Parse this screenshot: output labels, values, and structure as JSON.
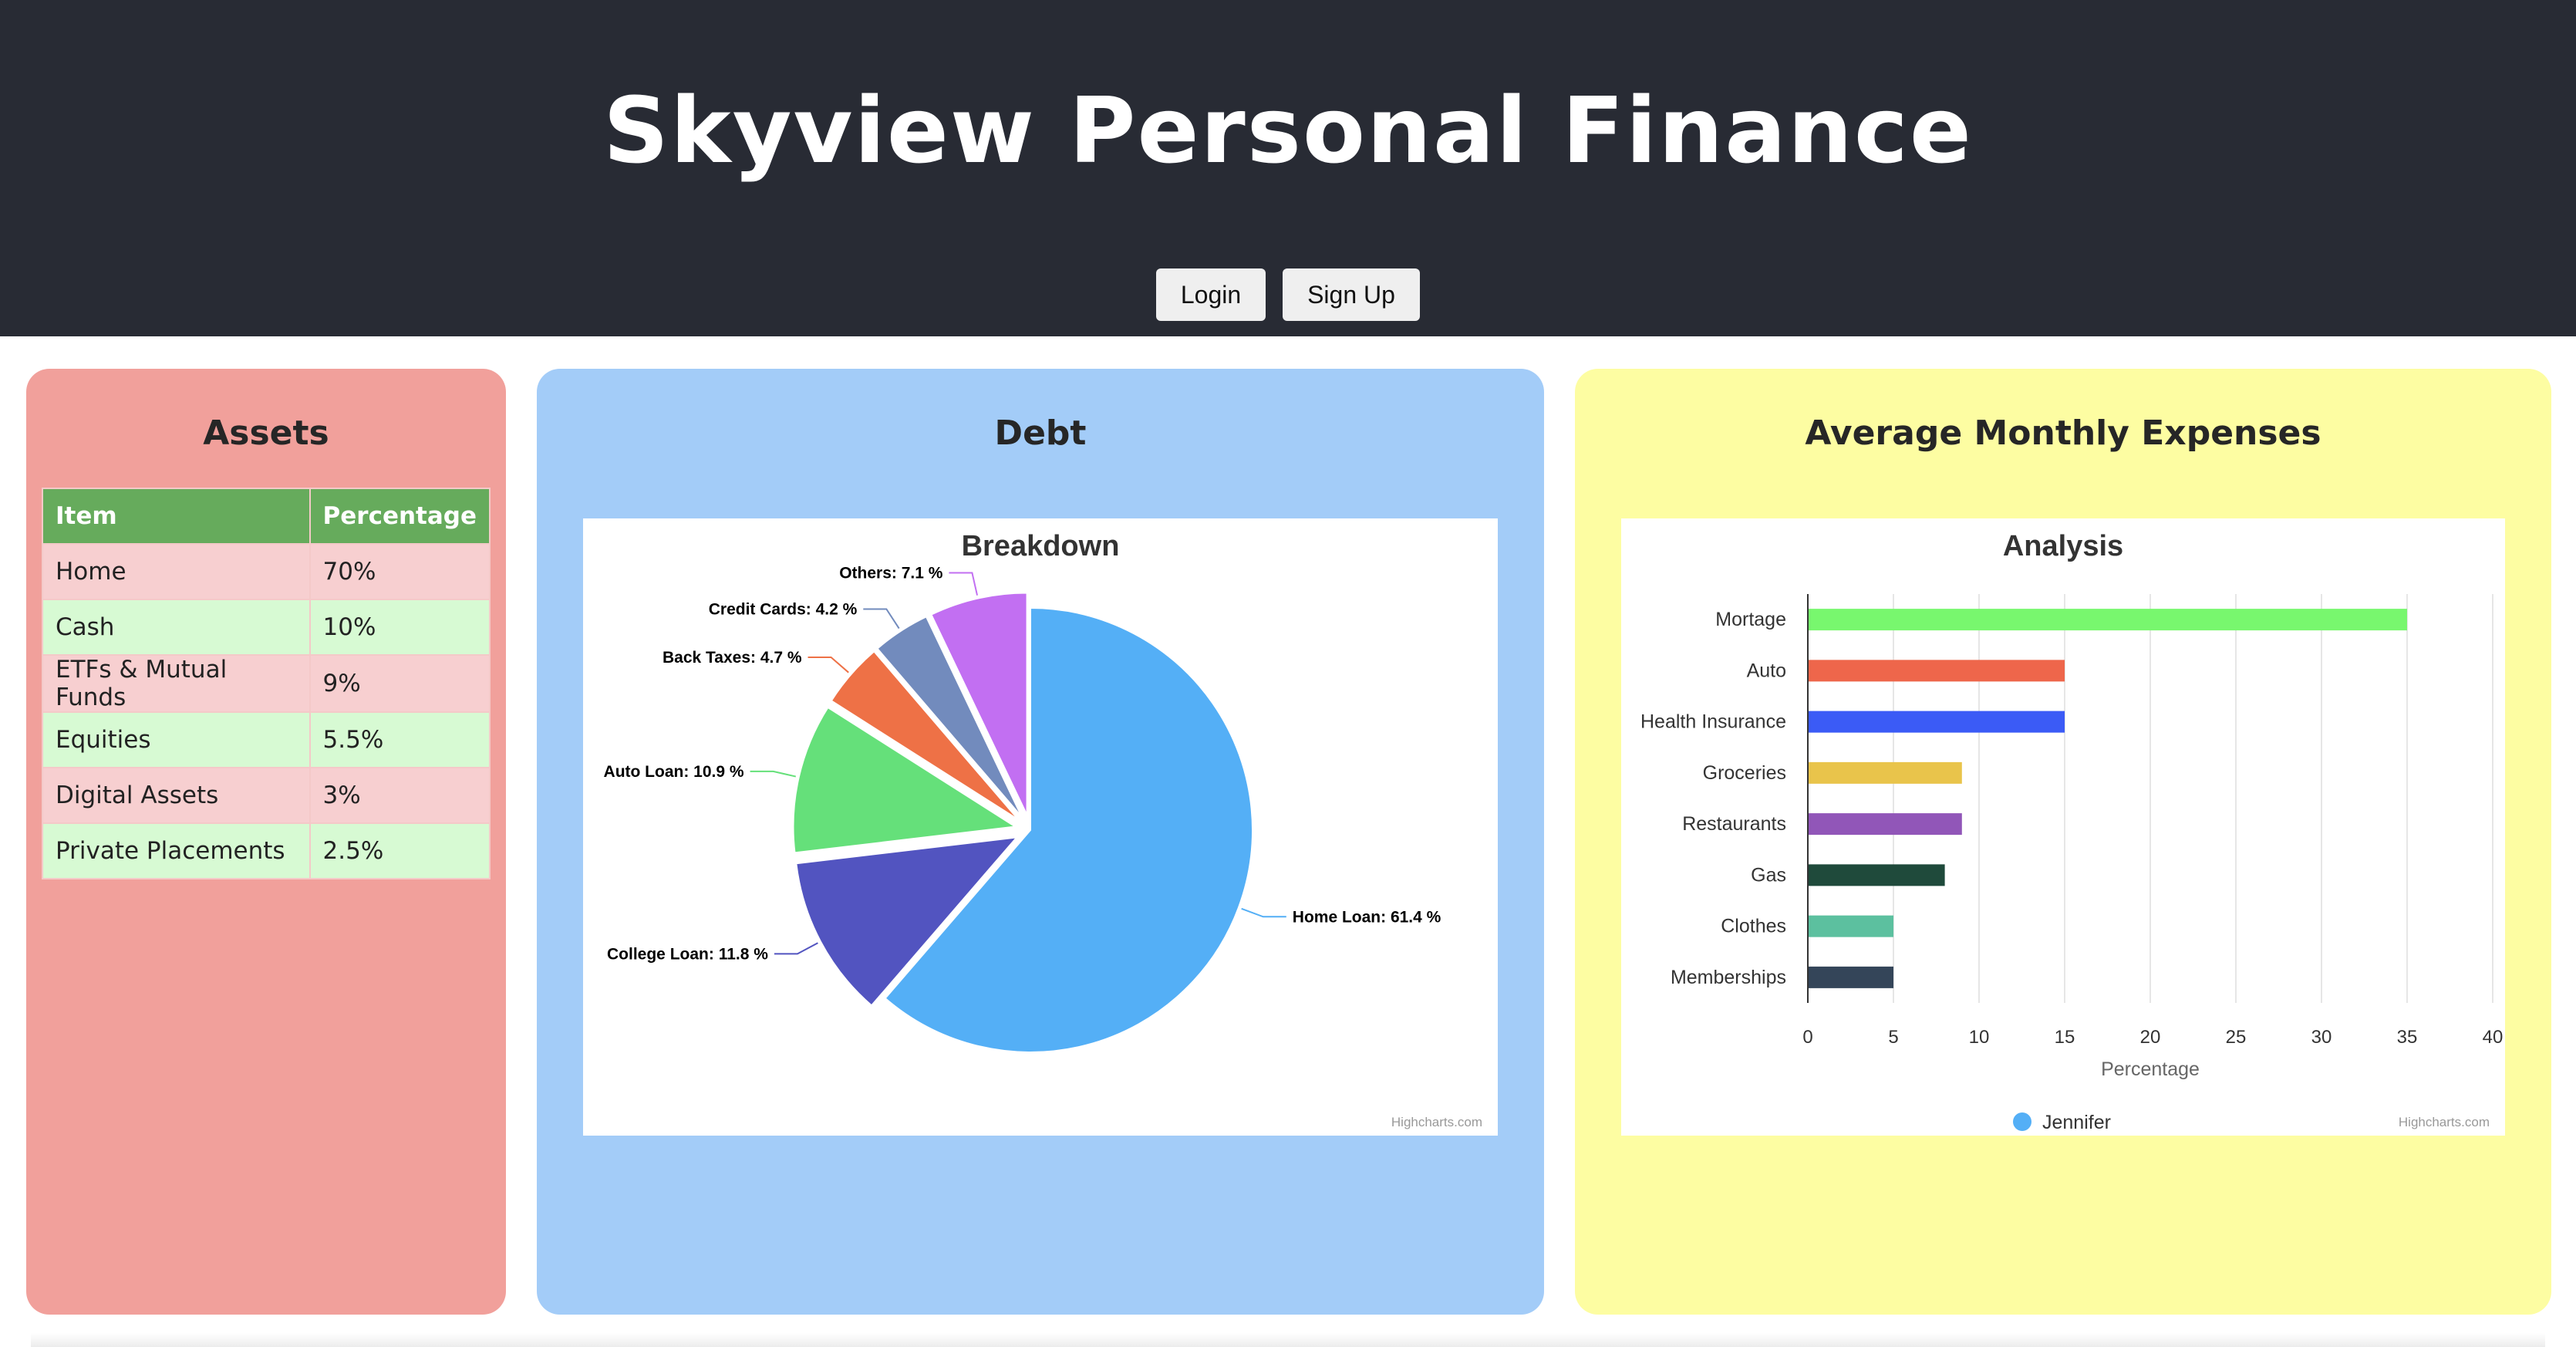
{
  "header": {
    "title": "Skyview Personal Finance",
    "login_label": "Login",
    "signup_label": "Sign Up"
  },
  "assets": {
    "title": "Assets",
    "columns": [
      "Item",
      "Percentage"
    ],
    "rows": [
      {
        "item": "Home",
        "percentage": "70%"
      },
      {
        "item": "Cash",
        "percentage": "10%"
      },
      {
        "item": "ETFs & Mutual Funds",
        "percentage": "9%"
      },
      {
        "item": "Equities",
        "percentage": "5.5%"
      },
      {
        "item": "Digital Assets",
        "percentage": "3%"
      },
      {
        "item": "Private Placements",
        "percentage": "2.5%"
      }
    ]
  },
  "debt": {
    "title": "Debt"
  },
  "expenses": {
    "title": "Average Monthly Expenses"
  },
  "credits": "Highcharts.com",
  "colors": {
    "header_bg": "#282b34",
    "assets_card": "#f1a09b",
    "debt_card": "#a3ccf8",
    "expenses_card": "#fdfda2",
    "table_header": "#66ab5c",
    "row_pink": "#f7cfd0",
    "row_green": "#d7fad3"
  },
  "chart_data": [
    {
      "type": "pie",
      "title": "Breakdown",
      "slices": [
        {
          "name": "Home Loan",
          "value": 61.4,
          "label": "Home Loan: 61.4 %",
          "color": "#54aff6",
          "sliced": false
        },
        {
          "name": "College Loan",
          "value": 11.8,
          "label": "College Loan: 11.8 %",
          "color": "#5254c0",
          "sliced": true
        },
        {
          "name": "Auto Loan",
          "value": 10.9,
          "label": "Auto Loan: 10.9 %",
          "color": "#65e07a",
          "sliced": true
        },
        {
          "name": "Back Taxes",
          "value": 4.7,
          "label": "Back Taxes: 4.7 %",
          "color": "#ee7146",
          "sliced": true
        },
        {
          "name": "Credit Cards",
          "value": 4.2,
          "label": "Credit Cards: 4.2 %",
          "color": "#728bbd",
          "sliced": true
        },
        {
          "name": "Others",
          "value": 7.1,
          "label": "Others: 7.1 %",
          "color": "#c26ff2",
          "sliced": true
        }
      ]
    },
    {
      "type": "bar",
      "orientation": "horizontal",
      "title": "Analysis",
      "xlabel": "Percentage",
      "xlim": [
        0,
        40
      ],
      "ticks": [
        0,
        5,
        10,
        15,
        20,
        25,
        30,
        35,
        40
      ],
      "grid": true,
      "legend": "bottom-center",
      "series": [
        {
          "name": "Jennifer",
          "legend_color": "#54aff6",
          "categories": [
            "Mortage",
            "Auto",
            "Health Insurance",
            "Groceries",
            "Restaurants",
            "Gas",
            "Clothes",
            "Memberships"
          ],
          "values": [
            35,
            15,
            15,
            9,
            9,
            8,
            5,
            5
          ],
          "colors": [
            "#78f76e",
            "#ee664b",
            "#3b5bf6",
            "#e9c44b",
            "#9156b8",
            "#1f4a3b",
            "#5cc09f",
            "#344559"
          ]
        }
      ]
    }
  ]
}
